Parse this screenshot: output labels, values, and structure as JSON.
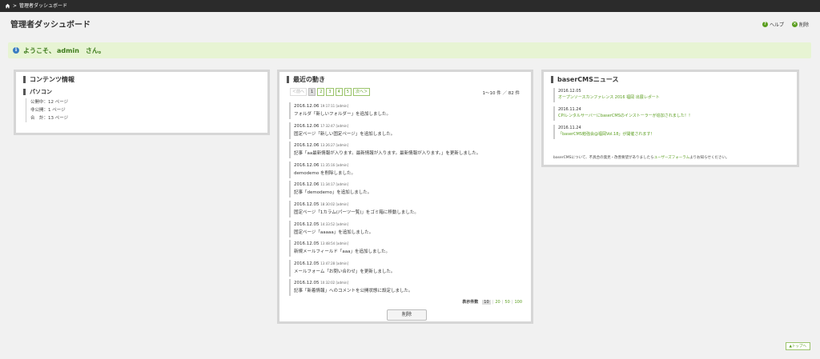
{
  "topbar": {
    "breadcrumb_sep": ">",
    "breadcrumb_current": "管理者ダッシュボード"
  },
  "page": {
    "title": "管理者ダッシュボード",
    "help_label": "ヘルプ",
    "delete_label": "削除"
  },
  "welcome": {
    "prefix": "ようこそ、",
    "user": "admin",
    "suffix": "さん。"
  },
  "contents_panel": {
    "title": "コンテンツ情報",
    "subtitle": "パソコン",
    "stats": [
      "公開中：12 ページ",
      "非公開：1 ページ",
      "合　計：13 ページ"
    ]
  },
  "activity_panel": {
    "title": "最近の動き",
    "pager": {
      "prev": "＜前へ",
      "pages": [
        "1",
        "2",
        "3",
        "4",
        "5"
      ],
      "next": "次へ＞"
    },
    "count_text": "1〜10 件 ／ 82 件",
    "entries": [
      {
        "date": "2016.12.06",
        "time": "19:17:11 [admin]",
        "msg": "フォルダ「新しいフォルダー」を追加しました。"
      },
      {
        "date": "2016.12.06",
        "time": "17:32:47 [admin]",
        "msg": "固定ページ「新しい固定ページ」を追加しました。"
      },
      {
        "date": "2016.12.06",
        "time": "13:26:27 [admin]",
        "msg": "記事「aa最新情報が入ります。最新情報が入ります。最新情報が入ります。」を更新しました。"
      },
      {
        "date": "2016.12.06",
        "time": "11:35:16 [admin]",
        "msg": "demodemo を削除しました。"
      },
      {
        "date": "2016.12.06",
        "time": "11:34:17 [admin]",
        "msg": "記事「demodemo」を追加しました。"
      },
      {
        "date": "2016.12.05",
        "time": "18:30:02 [admin]",
        "msg": "固定ページ「1カラム(パーツ一覧)」をゴミ箱に移動しました。"
      },
      {
        "date": "2016.12.05",
        "time": "14:33:52 [admin]",
        "msg": "固定ページ「aaaaa」を追加しました。"
      },
      {
        "date": "2016.12.05",
        "time": "13:48:54 [admin]",
        "msg": "新規メールフィールド「aaa」を追加しました。"
      },
      {
        "date": "2016.12.05",
        "time": "13:47:28 [admin]",
        "msg": "メールフォーム「お問い合わせ」を更新しました。"
      },
      {
        "date": "2016.12.05",
        "time": "10:32:02 [admin]",
        "msg": "記事「新着情報」へのコメントを公開状態に設定しました。"
      }
    ],
    "perpage_label": "表示件数",
    "perpage_options": [
      "10",
      "20",
      "50",
      "100"
    ],
    "delete_button": "削除"
  },
  "news_panel": {
    "title": "baserCMSニュース",
    "items": [
      {
        "date": "2016.12.05",
        "title": "オープンソースカンファレンス 2016 福岡 出展レポート"
      },
      {
        "date": "2016.11.24",
        "title": "CPIレンタルサーバーにbaserCMSのインストーラーが追加されました！！"
      },
      {
        "date": "2016.11.24",
        "title": "「baserCMS勉強会@福岡Vol.18」が開催されます！"
      }
    ],
    "footer_pre": "baserCMSについて、不具合の発見・改善要望がありましたら",
    "footer_link": "ユーザーズフォーラム",
    "footer_post": "よりお知らせください。"
  },
  "totop_label": "▲トップへ"
}
